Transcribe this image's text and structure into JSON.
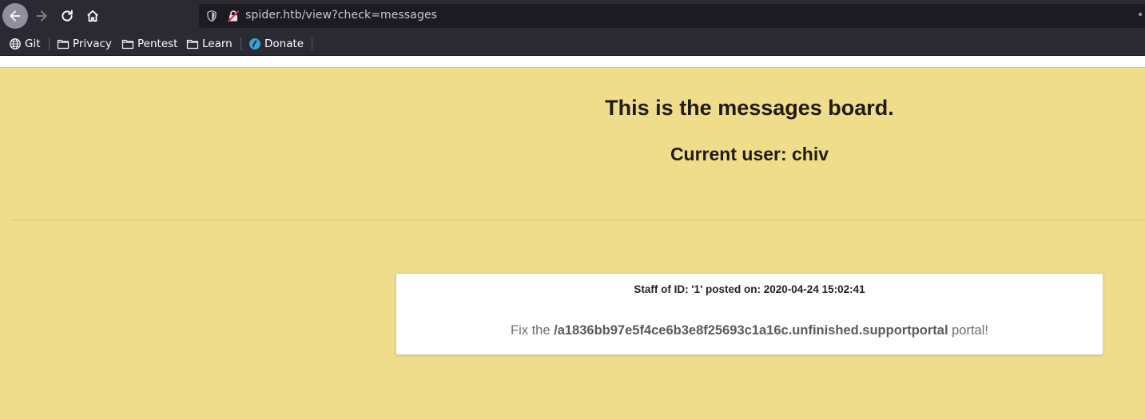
{
  "browser": {
    "url": "spider.htb/view?check=messages",
    "url_overflow": "••",
    "bookmarks": [
      {
        "label": "Git",
        "icon": "globe-icon"
      },
      {
        "label": "Privacy",
        "icon": "folder-icon"
      },
      {
        "label": "Pentest",
        "icon": "folder-icon"
      },
      {
        "label": "Learn",
        "icon": "folder-icon"
      },
      {
        "label": "Donate",
        "icon": "donate-icon"
      }
    ],
    "chrome_color": "#2b2a33",
    "urlbar_color": "#1c1b22"
  },
  "page": {
    "background": "#efdd8b",
    "title": "This is the messages board.",
    "current_user_label": "Current user: chiv",
    "messages": [
      {
        "meta": "Staff of ID: '1' posted on: 2020-04-24 15:02:41",
        "text_before": "Fix the",
        "path": "/a1836bb97e5f4ce6b3e8f25693c1a16c.unfinished.supportportal",
        "text_after": "portal!"
      }
    ]
  }
}
